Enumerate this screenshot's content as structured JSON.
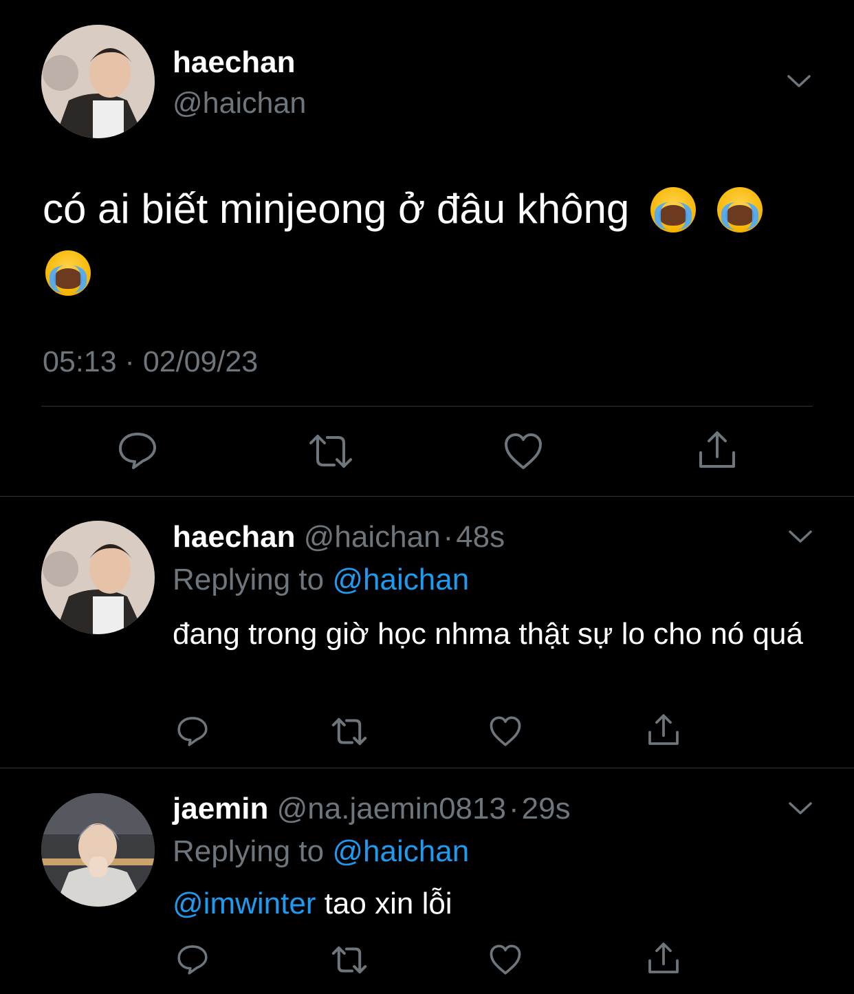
{
  "main_tweet": {
    "display_name": "haechan",
    "handle": "@haichan",
    "text": "có ai biết minjeong ở đâu không",
    "emoji_icon": "loudly-crying-face-icon",
    "emoji_count": 3,
    "timestamp": "05:13 · 02/09/23"
  },
  "replies": [
    {
      "display_name": "haechan",
      "handle": "@haichan",
      "separator": "·",
      "time": "48s",
      "replying_label": "Replying to",
      "replying_handle": "@haichan",
      "mention": "",
      "text": "đang trong giờ học nhma thật sự lo cho nó quá"
    },
    {
      "display_name": "jaemin",
      "handle": "@na.jaemin0813",
      "separator": "·",
      "time": "29s",
      "replying_label": "Replying to",
      "replying_handle": "@haichan",
      "mention": "@imwinter",
      "text": "tao xin lỗi"
    }
  ],
  "icons": {
    "menu": "chevron-down-icon",
    "reply": "reply-icon",
    "retweet": "retweet-icon",
    "like": "heart-icon",
    "share": "share-icon"
  },
  "colors": {
    "background": "#000000",
    "muted": "#6e767d",
    "link": "#1d9bf0",
    "divider": "#2f3336"
  }
}
